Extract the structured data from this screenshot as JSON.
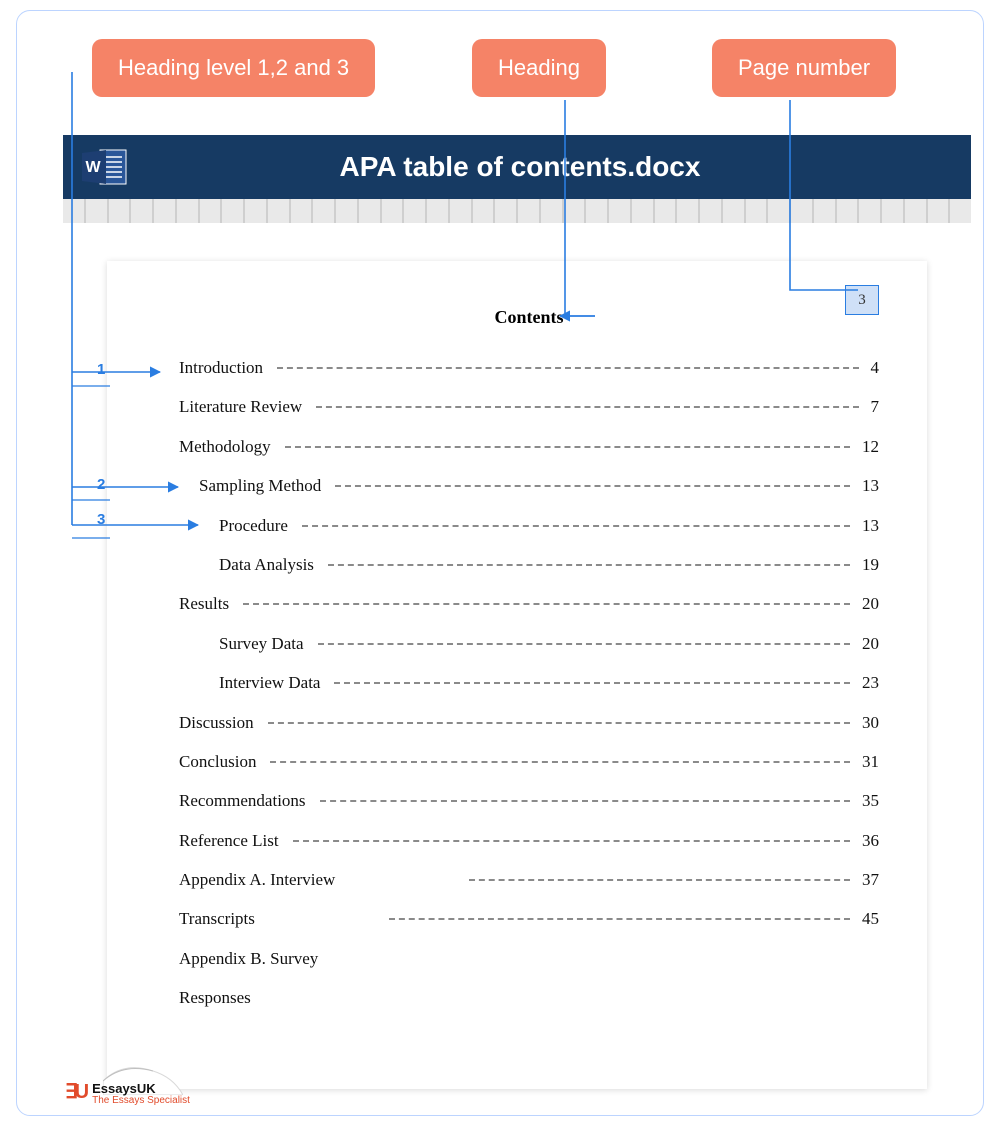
{
  "callouts": {
    "levels": "Heading level 1,2 and 3",
    "heading": "Heading",
    "pagenum": "Page number"
  },
  "titlebar": {
    "filename": "APA table of contents.docx",
    "app_letter": "W"
  },
  "page": {
    "number": "3",
    "contents_heading": "Contents"
  },
  "toc": [
    {
      "level": 1,
      "label": "Introduction",
      "page": "4"
    },
    {
      "level": 1,
      "label": "Literature Review",
      "page": "7"
    },
    {
      "level": 1,
      "label": "Methodology",
      "page": "12"
    },
    {
      "level": 2,
      "label": "Sampling Method",
      "page": "13"
    },
    {
      "level": 3,
      "label": "Procedure",
      "page": "13"
    },
    {
      "level": 3,
      "label": "Data Analysis",
      "page": "19"
    },
    {
      "level": 1,
      "label": "Results",
      "page": "20"
    },
    {
      "level": 3,
      "label": "Survey Data",
      "page": "20"
    },
    {
      "level": 3,
      "label": "Interview Data",
      "page": "23"
    },
    {
      "level": 1,
      "label": "Discussion",
      "page": "30"
    },
    {
      "level": 1,
      "label": "Conclusion",
      "page": "31"
    },
    {
      "level": 1,
      "label": "Recommendations",
      "page": "35"
    },
    {
      "level": 1,
      "label": "Reference List",
      "page": "36"
    },
    {
      "level": 1,
      "label": "Appendix A. Interview",
      "page": "37",
      "short_leader": true
    },
    {
      "level": 1,
      "label": "Transcripts",
      "page": "45",
      "short_leader": true
    },
    {
      "level": 1,
      "label": "Appendix B. Survey",
      "page": "",
      "no_page": true
    },
    {
      "level": 1,
      "label": "Responses",
      "page": "",
      "no_page": true
    }
  ],
  "level_markers": {
    "l1": "1",
    "l2": "2",
    "l3": "3"
  },
  "brand": {
    "mark": "∃U",
    "name": "EssaysUK",
    "tagline": "The Essays Specialist"
  }
}
